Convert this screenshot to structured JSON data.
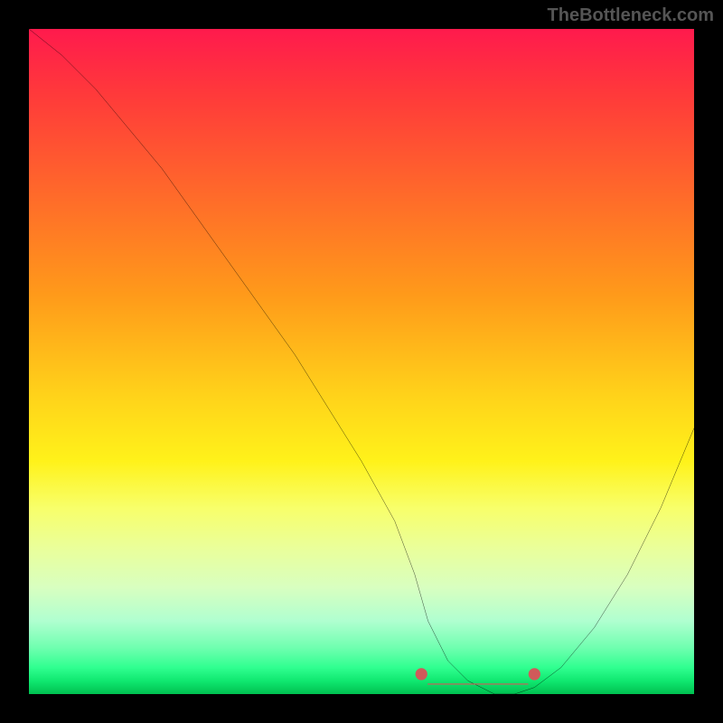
{
  "watermark": "TheBottleneck.com",
  "chart_data": {
    "type": "line",
    "title": "",
    "xlabel": "",
    "ylabel": "",
    "xlim": [
      0,
      100
    ],
    "ylim": [
      0,
      100
    ],
    "series": [
      {
        "name": "bottleneck-curve",
        "x": [
          0,
          5,
          10,
          15,
          20,
          25,
          30,
          35,
          40,
          45,
          50,
          55,
          58,
          60,
          63,
          66,
          70,
          73,
          76,
          80,
          85,
          90,
          95,
          100
        ],
        "y": [
          100,
          96,
          91,
          85,
          79,
          72,
          65,
          58,
          51,
          43,
          35,
          26,
          18,
          11,
          5,
          2,
          0,
          0,
          1,
          4,
          10,
          18,
          28,
          40
        ]
      }
    ],
    "markers": [
      {
        "name": "flat-start-dot",
        "x": 59,
        "y": 3
      },
      {
        "name": "flat-end-dot",
        "x": 76,
        "y": 3
      }
    ],
    "flat_segment": {
      "x_start": 60,
      "x_end": 75,
      "y": 1.5
    },
    "gradient_stops": [
      {
        "pos": 0,
        "color": "#ff1a4d"
      },
      {
        "pos": 25,
        "color": "#ff6a2a"
      },
      {
        "pos": 55,
        "color": "#ffd21a"
      },
      {
        "pos": 75,
        "color": "#eaff9a"
      },
      {
        "pos": 100,
        "color": "#00c050"
      }
    ]
  }
}
